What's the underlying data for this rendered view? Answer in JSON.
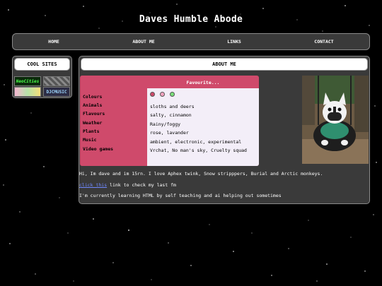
{
  "site": {
    "title": "Daves Humble Abode"
  },
  "nav": {
    "items": [
      {
        "id": "home",
        "label": "HOME"
      },
      {
        "id": "about",
        "label": "ABOUT ME"
      },
      {
        "id": "links",
        "label": "LINKS"
      },
      {
        "id": "contact",
        "label": "CONTACT"
      }
    ]
  },
  "sidebar": {
    "title": "COOL SITES",
    "badges": [
      {
        "label": "NeoCities"
      },
      {
        "label": ""
      },
      {
        "label": ""
      },
      {
        "label": "DJCMUSIC"
      }
    ]
  },
  "main": {
    "header": "ABOUT ME",
    "favourites": {
      "heading": "Favourite...",
      "colour_swatches": [
        "#cf4a6b",
        "#f5a3c0",
        "#7be07b"
      ],
      "categories": [
        "Colours",
        "Animals",
        "Flavours",
        "Weather",
        "Plants",
        "Music",
        "Video games"
      ],
      "values": [
        "",
        "sloths and deers",
        "salty, cinnamon",
        "Rainy/foggy",
        "rose, lavander",
        "ambient, electronic, experimental",
        "Vrchat, No man's sky, Cruelty squad"
      ]
    },
    "bio": {
      "line1": "Hi, Im dave and im 15rn. I love Aphex twink, Snow stripppers, Burial and Arctic monkeys.",
      "link_text": "click this",
      "line2_rest": " link to check my last fm",
      "line3": "I'm currently learning HTML by self teaching and ai helping out sometimes"
    }
  }
}
